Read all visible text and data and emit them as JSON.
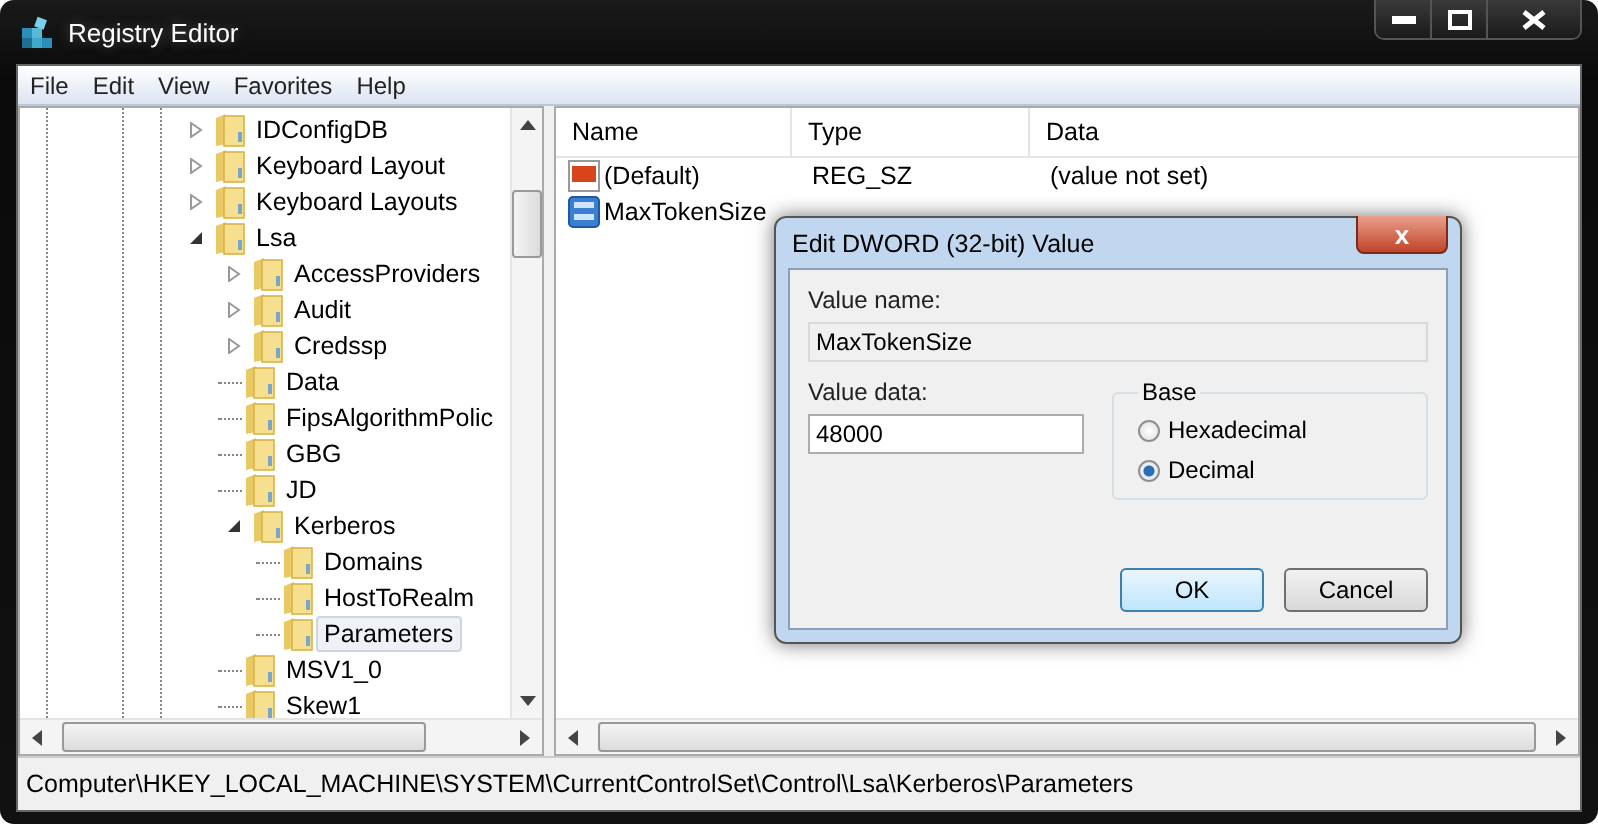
{
  "window": {
    "title": "Registry Editor"
  },
  "menu": [
    "File",
    "Edit",
    "View",
    "Favorites",
    "Help"
  ],
  "tree": [
    {
      "label": "IDConfigDB",
      "kind": "collapsed",
      "selected": false
    },
    {
      "label": "Keyboard Layout",
      "kind": "collapsed",
      "selected": false
    },
    {
      "label": "Keyboard Layouts",
      "kind": "collapsed",
      "selected": false
    },
    {
      "label": "Lsa",
      "kind": "expanded",
      "selected": false,
      "children": [
        {
          "label": "AccessProviders",
          "kind": "collapsed",
          "selected": false
        },
        {
          "label": "Audit",
          "kind": "collapsed",
          "selected": false
        },
        {
          "label": "Credssp",
          "kind": "collapsed",
          "selected": false
        },
        {
          "label": "Data",
          "kind": "leaf",
          "selected": false
        },
        {
          "label": "FipsAlgorithmPolic",
          "kind": "leaf",
          "selected": false
        },
        {
          "label": "GBG",
          "kind": "leaf",
          "selected": false
        },
        {
          "label": "JD",
          "kind": "leaf",
          "selected": false
        },
        {
          "label": "Kerberos",
          "kind": "expanded",
          "selected": false,
          "children": [
            {
              "label": "Domains",
              "kind": "leaf",
              "selected": false
            },
            {
              "label": "HostToRealm",
              "kind": "leaf",
              "selected": false
            },
            {
              "label": "Parameters",
              "kind": "leaf",
              "selected": true
            }
          ]
        },
        {
          "label": "MSV1_0",
          "kind": "leaf",
          "selected": false
        },
        {
          "label": "Skew1",
          "kind": "leaf",
          "selected": false
        }
      ]
    }
  ],
  "table": {
    "columns": [
      "Name",
      "Type",
      "Data"
    ],
    "rows": [
      {
        "kind": "string",
        "name": "(Default)",
        "type": "REG_SZ",
        "data": "(value not set)"
      },
      {
        "kind": "binary",
        "name": "MaxTokenSize"
      }
    ]
  },
  "dialog": {
    "title": "Edit DWORD (32-bit) Value",
    "close": "x",
    "value_name_label": "Value name:",
    "value_name": "MaxTokenSize",
    "value_data_label": "Value data:",
    "value_data": "48000",
    "base_label": "Base",
    "bases": [
      {
        "label": "Hexadecimal",
        "selected": false
      },
      {
        "label": "Decimal",
        "selected": true
      }
    ],
    "buttons": [
      {
        "label": "OK",
        "default": true
      },
      {
        "label": "Cancel",
        "default": false
      }
    ]
  },
  "status_bar": "Computer\\HKEY_LOCAL_MACHINE\\SYSTEM\\CurrentControlSet\\Control\\Lsa\\Kerberos\\Parameters"
}
